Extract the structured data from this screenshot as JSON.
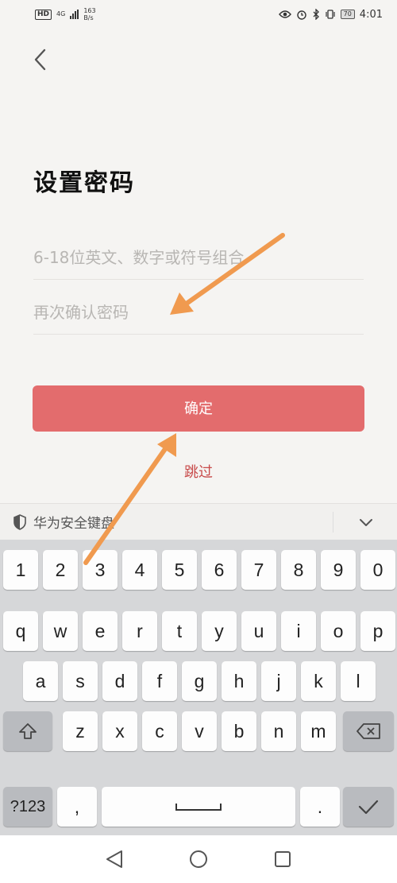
{
  "status_bar": {
    "hd": "HD",
    "network": "4G",
    "speed_value": "163",
    "speed_unit": "B/s",
    "battery": "70",
    "time": "4:01"
  },
  "page": {
    "title": "设置密码"
  },
  "form": {
    "password_placeholder": "6-18位英文、数字或符号组合",
    "confirm_placeholder": "再次确认密码",
    "confirm_button": "确定",
    "skip_link": "跳过"
  },
  "keyboard": {
    "label": "华为安全键盘",
    "row_numbers": [
      "1",
      "2",
      "3",
      "4",
      "5",
      "6",
      "7",
      "8",
      "9",
      "0"
    ],
    "row_top": [
      "q",
      "w",
      "e",
      "r",
      "t",
      "y",
      "u",
      "i",
      "o",
      "p"
    ],
    "row_middle": [
      "a",
      "s",
      "d",
      "f",
      "g",
      "h",
      "j",
      "k",
      "l"
    ],
    "row_bottom": [
      "z",
      "x",
      "c",
      "v",
      "b",
      "n",
      "m"
    ],
    "symbols_key": "?123",
    "comma_key": ",",
    "period_key": "."
  },
  "colors": {
    "confirm_button": "#e36c6d",
    "skip_link": "#c84a4a",
    "arrow": "#f09a4f"
  }
}
